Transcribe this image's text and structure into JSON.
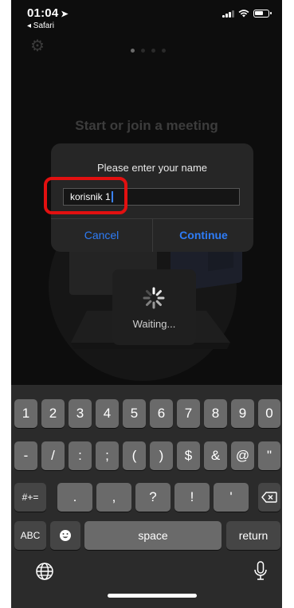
{
  "status_bar": {
    "time": "01:04",
    "back_app": "◂ Safari"
  },
  "background": {
    "title": "Start or join a meeting"
  },
  "dialog": {
    "title": "Please enter your name",
    "input_value": "korisnik 1",
    "cancel_label": "Cancel",
    "continue_label": "Continue"
  },
  "waiting": {
    "label": "Waiting..."
  },
  "keyboard": {
    "row1": [
      "1",
      "2",
      "3",
      "4",
      "5",
      "6",
      "7",
      "8",
      "9",
      "0"
    ],
    "row2": [
      "-",
      "/",
      ":",
      ";",
      "(",
      ")",
      "$",
      "&",
      "@",
      "\""
    ],
    "row3_shift": "#+=",
    "row3": [
      ".",
      ",",
      "?",
      "!",
      "'"
    ],
    "abc": "ABC",
    "space": "space",
    "return": "return"
  },
  "colors": {
    "accent": "#2e7cf6",
    "highlight": "#e21010"
  }
}
